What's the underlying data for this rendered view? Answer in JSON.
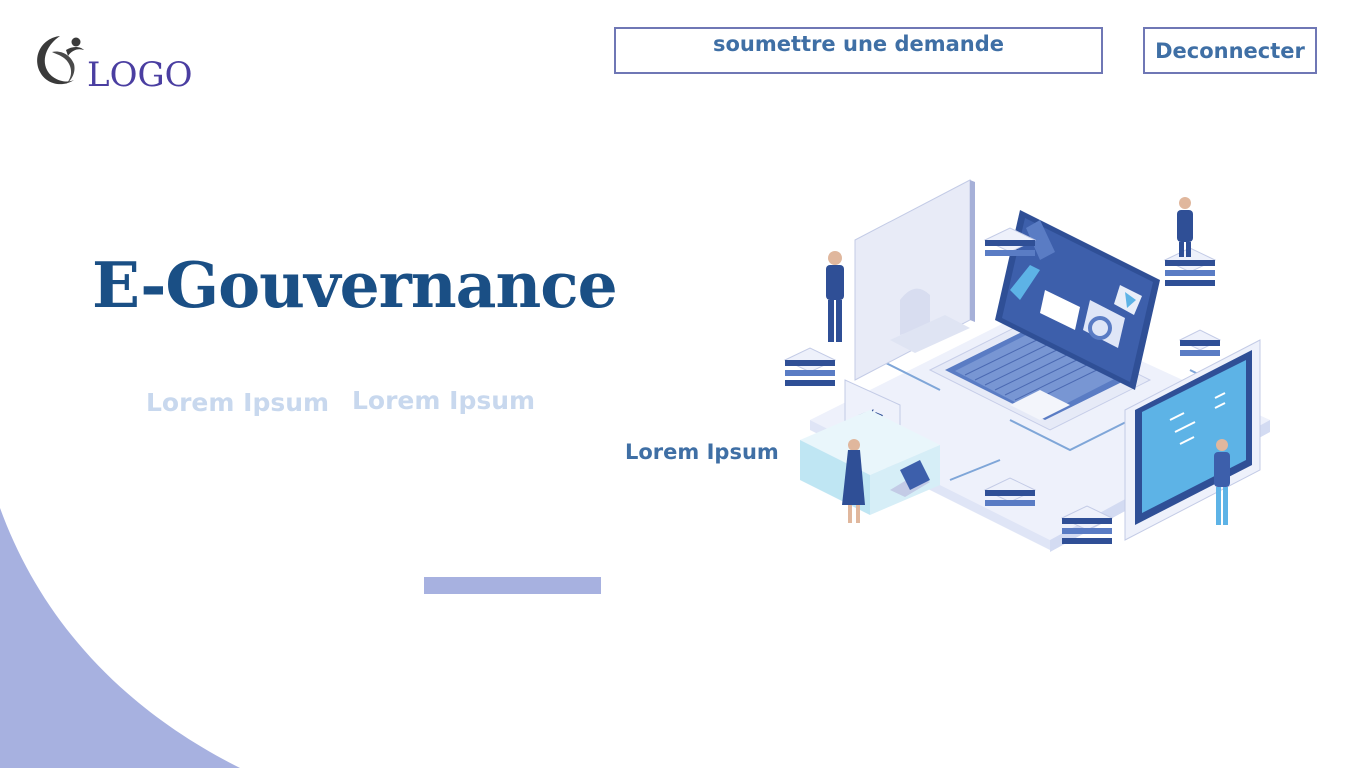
{
  "colors": {
    "brand_logo": "#4a3ea1",
    "title": "#1a4f85",
    "button_text": "#3f6fa5",
    "button_border": "#6f77b5",
    "subtitle_faded": "#c8d8ee",
    "accent": "#a7b1e0"
  },
  "header": {
    "logo_text": "LOGO",
    "logo_icon": "swoosh-figure-icon",
    "submit_request_label": "soumettre une demande",
    "logout_label": "Deconnecter"
  },
  "hero": {
    "title": "E-Gouvernance",
    "subtitles": [
      "Lorem Ipsum",
      "Lorem Ipsum"
    ],
    "caption": "Lorem Ipsum",
    "illustration": "isometric-technology-workspace-illustration"
  }
}
